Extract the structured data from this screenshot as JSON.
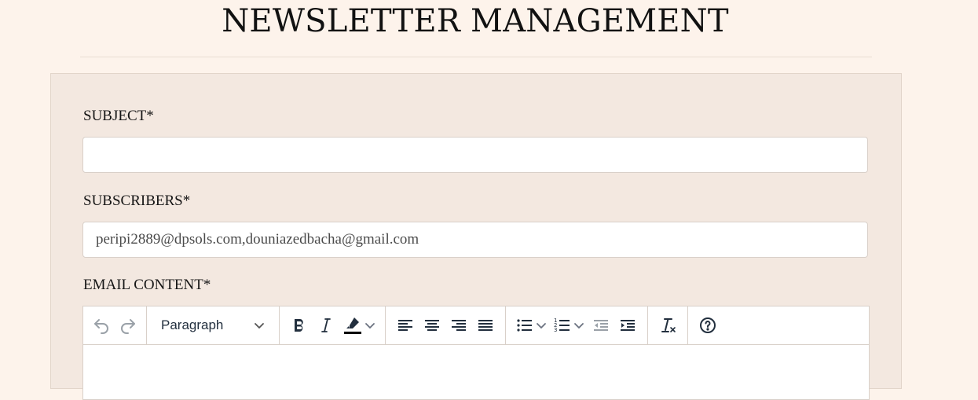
{
  "page": {
    "title": "NEWSLETTER MANAGEMENT"
  },
  "form": {
    "subject": {
      "label": "SUBJECT*",
      "value": ""
    },
    "subscribers": {
      "label": "SUBSCRIBERS*",
      "value": "peripi2889@dpsols.com,douniazedbacha@gmail.com"
    },
    "content": {
      "label": "EMAIL CONTENT*"
    }
  },
  "editor": {
    "block_format": "Paragraph",
    "toolbar_icons": [
      "undo-icon",
      "redo-icon",
      "bold-icon",
      "italic-icon",
      "highlight-icon",
      "align-left-icon",
      "align-center-icon",
      "align-right-icon",
      "justify-icon",
      "bullet-list-icon",
      "numbered-list-icon",
      "outdent-icon",
      "indent-icon",
      "clear-format-icon",
      "help-icon"
    ]
  },
  "colors": {
    "background": "#fdf3eb",
    "card": "#f3e8e0",
    "icon": "#222f3e"
  }
}
